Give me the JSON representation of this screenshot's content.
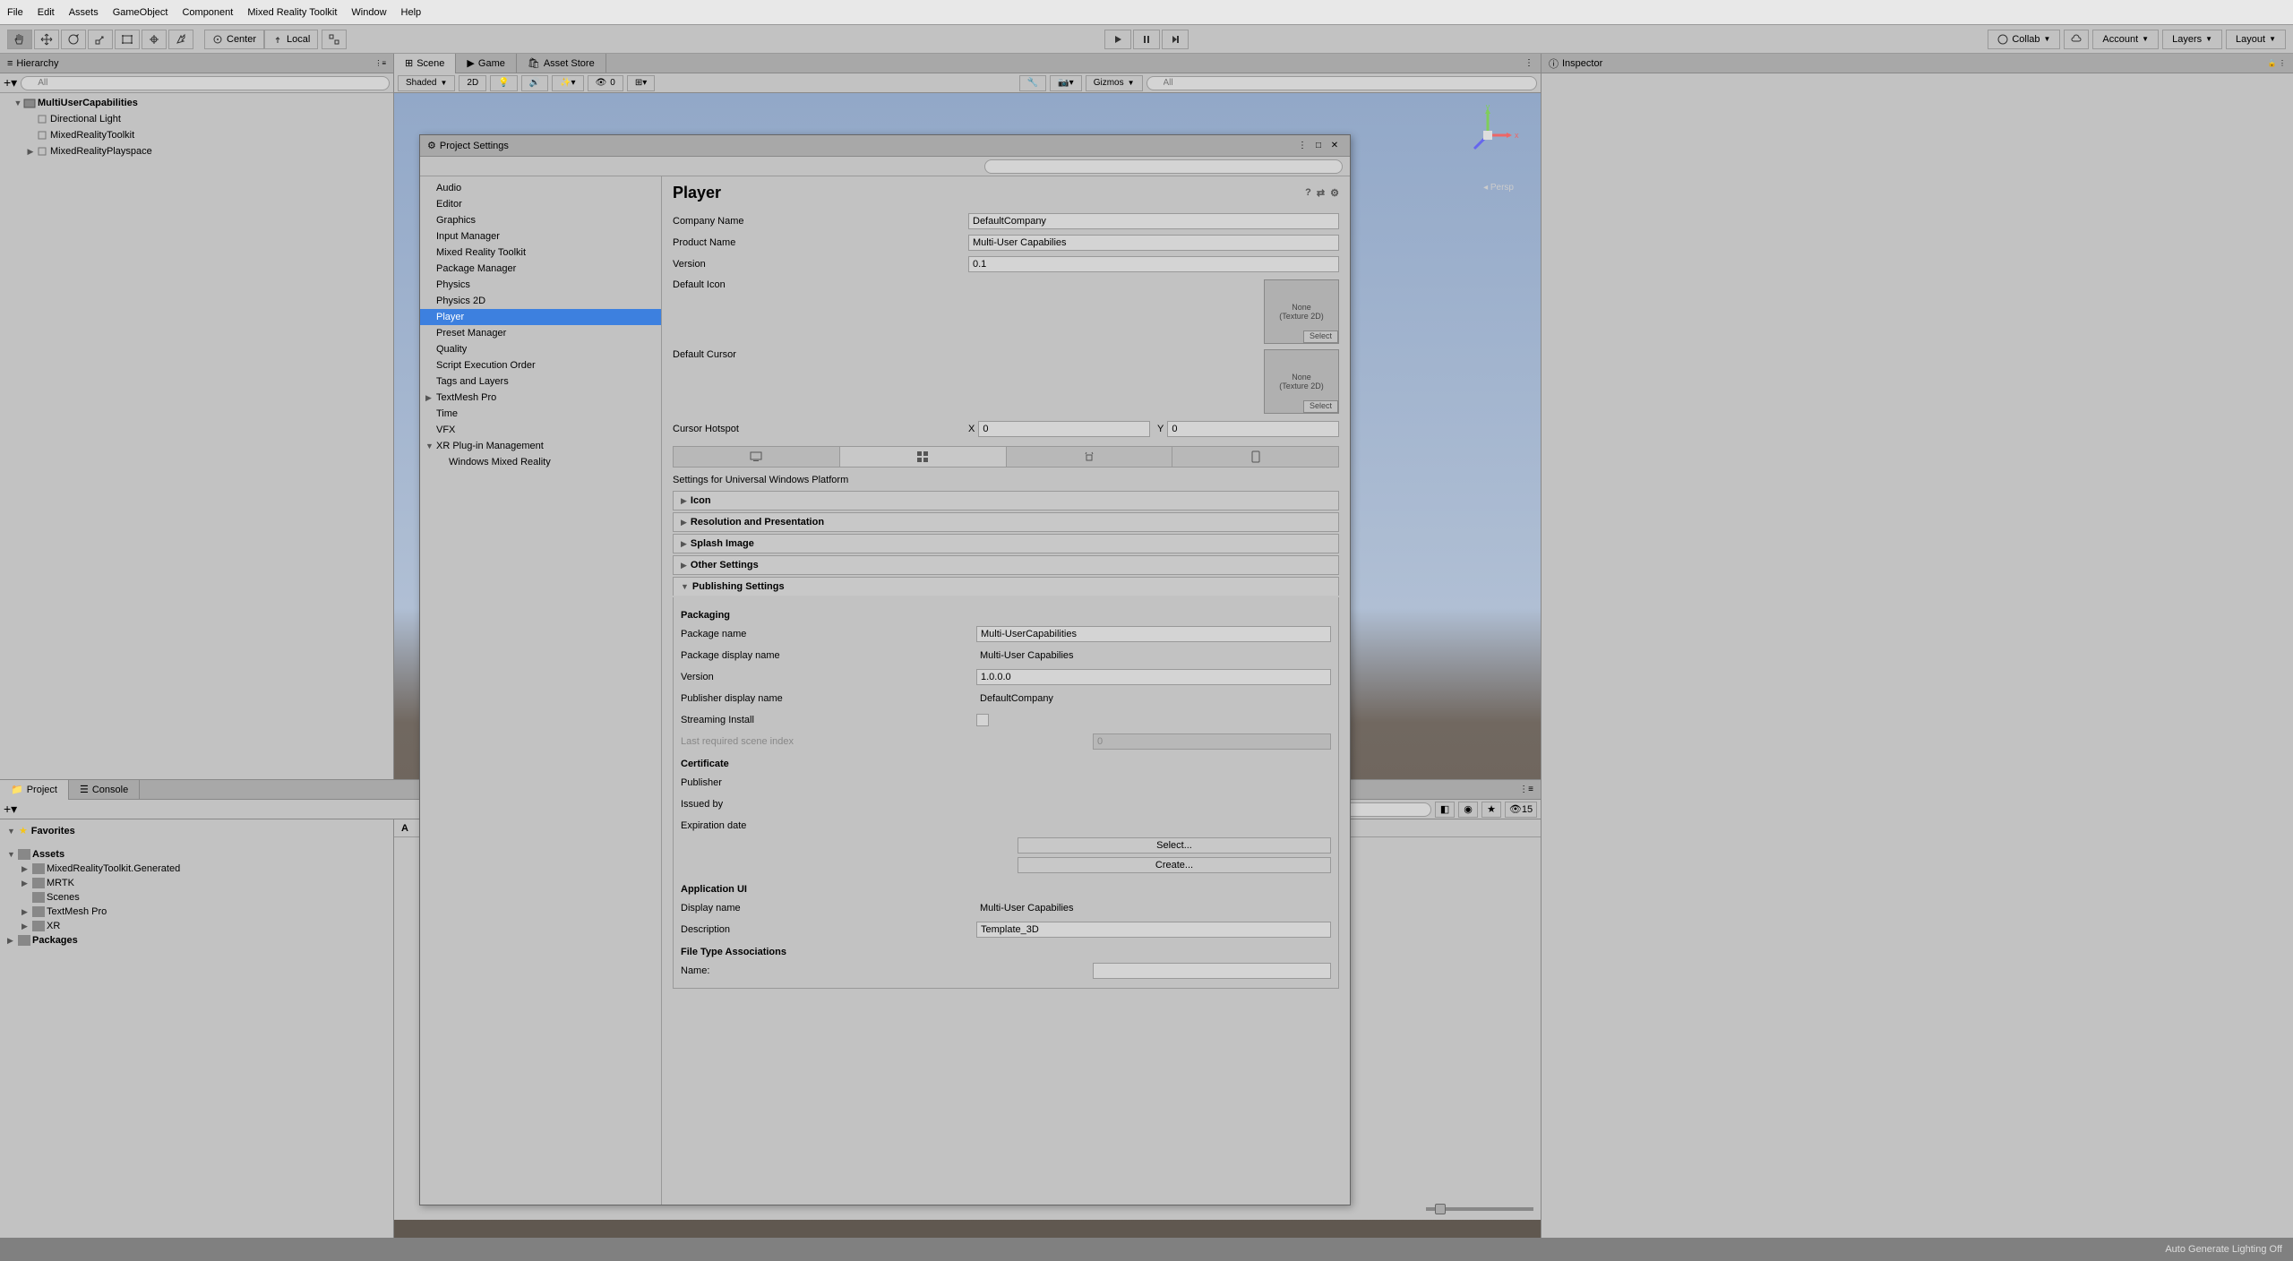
{
  "menu": {
    "file": "File",
    "edit": "Edit",
    "assets": "Assets",
    "gameobject": "GameObject",
    "component": "Component",
    "mrtk": "Mixed Reality Toolkit",
    "window": "Window",
    "help": "Help"
  },
  "toolbar": {
    "center": "Center",
    "local": "Local",
    "collab": "Collab",
    "account": "Account",
    "layers": "Layers",
    "layout": "Layout"
  },
  "hierarchy": {
    "title": "Hierarchy",
    "search_placeholder": "All",
    "scene": "MultiUserCapabilities",
    "items": [
      "Directional Light",
      "MixedRealityToolkit",
      "MixedRealityPlayspace"
    ]
  },
  "tabs": {
    "scene": "Scene",
    "game": "Game",
    "asset_store": "Asset Store"
  },
  "scene_toolbar": {
    "shaded": "Shaded",
    "two_d": "2D",
    "gizmos": "Gizmos",
    "search_placeholder": "All",
    "audio_count": "0"
  },
  "persp": "Persp",
  "inspector": {
    "title": "Inspector"
  },
  "bottom": {
    "project": "Project",
    "console": "Console",
    "favorites": "Favorites",
    "assets": "Assets",
    "folders": [
      "MixedRealityToolkit.Generated",
      "MRTK",
      "Scenes",
      "TextMesh Pro",
      "XR"
    ],
    "packages": "Packages",
    "breadcrumb_a": "A",
    "icon_count": "15"
  },
  "settings": {
    "title": "Project Settings",
    "categories": [
      "Audio",
      "Editor",
      "Graphics",
      "Input Manager",
      "Mixed Reality Toolkit",
      "Package Manager",
      "Physics",
      "Physics 2D",
      "Player",
      "Preset Manager",
      "Quality",
      "Script Execution Order",
      "Tags and Layers",
      "TextMesh Pro",
      "Time",
      "VFX",
      "XR Plug-in Management"
    ],
    "xr_sub": "Windows Mixed Reality",
    "selected": "Player",
    "player": {
      "header": "Player",
      "company_label": "Company Name",
      "company_value": "DefaultCompany",
      "product_label": "Product Name",
      "product_value": "Multi-User Capabilies",
      "version_label": "Version",
      "version_value": "0.1",
      "default_icon_label": "Default Icon",
      "default_cursor_label": "Default Cursor",
      "texture_none": "None",
      "texture_type": "(Texture 2D)",
      "select_btn": "Select",
      "cursor_hotspot_label": "Cursor Hotspot",
      "cursor_x_label": "X",
      "cursor_x": "0",
      "cursor_y_label": "Y",
      "cursor_y": "0",
      "platform_header": "Settings for Universal Windows Platform",
      "foldouts": {
        "icon": "Icon",
        "resolution": "Resolution and Presentation",
        "splash": "Splash Image",
        "other": "Other Settings",
        "publishing": "Publishing Settings"
      },
      "packaging": {
        "header": "Packaging",
        "package_name_label": "Package name",
        "package_name": "Multi-UserCapabilities",
        "display_name_label": "Package display name",
        "display_name": "Multi-User Capabilies",
        "version_label": "Version",
        "version": "1.0.0.0",
        "publisher_label": "Publisher display name",
        "publisher": "DefaultCompany",
        "streaming_label": "Streaming Install",
        "last_scene_label": "Last required scene index",
        "last_scene": "0"
      },
      "certificate": {
        "header": "Certificate",
        "publisher_label": "Publisher",
        "issued_label": "Issued by",
        "expiration_label": "Expiration date",
        "select_btn": "Select...",
        "create_btn": "Create..."
      },
      "app_ui": {
        "header": "Application UI",
        "display_name_label": "Display name",
        "display_name": "Multi-User Capabilies",
        "description_label": "Description",
        "description": "Template_3D"
      },
      "file_assoc": {
        "header": "File Type Associations",
        "name_label": "Name:"
      }
    }
  },
  "statusbar": {
    "lighting": "Auto Generate Lighting Off"
  }
}
